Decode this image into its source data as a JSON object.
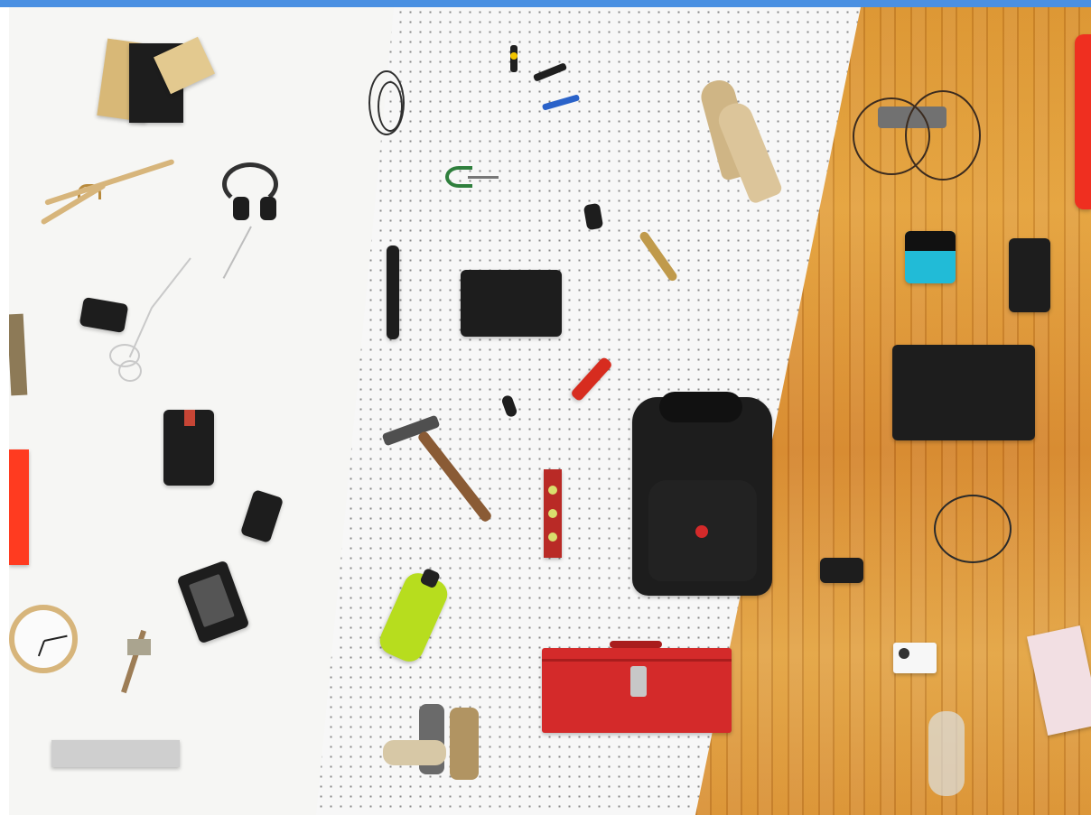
{
  "scene": {
    "description_visible": false
  },
  "theme": {
    "top_bar": "#4a90e2",
    "white_surface": "#f6f6f4",
    "pegboard": "#f7f7f7",
    "wood": "#d9902d",
    "red": "#d42a2a",
    "yellow_green": "#b7dd1e",
    "black": "#1d1d1d"
  },
  "icons": {
    "notebook": "notebook-icon",
    "hanger": "hanger-icon",
    "headphones": "headphones-icon",
    "camera": "camera-icon",
    "tablet": "tablet-icon",
    "phone": "phone-icon",
    "ereader": "ereader-icon",
    "clock": "clock-icon",
    "ruler": "ruler-icon",
    "hammer": "hammer-icon",
    "backpack": "backpack-icon",
    "toolbox": "toolbox-icon",
    "bottle": "bottle-icon",
    "gloves": "gloves-icon",
    "speaker": "speaker-icon",
    "game_console": "game-console-icon",
    "drawing_tablet": "drawing-tablet-icon"
  }
}
